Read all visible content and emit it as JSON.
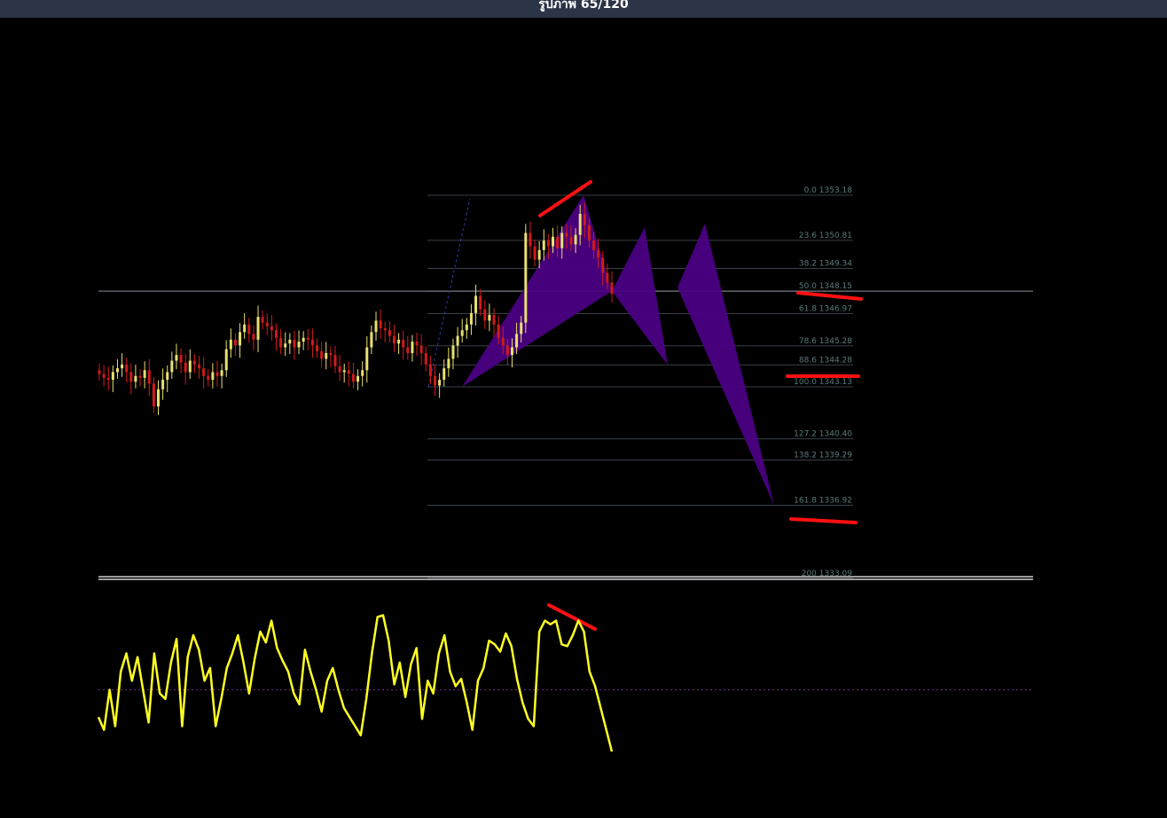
{
  "viewer": {
    "counter": "รูปภาพ 65/120"
  },
  "colors": {
    "background": "#000000",
    "bull_candle": "#e8e070",
    "bear_candle": "#d11a1a",
    "pattern_fill": "#4b0082",
    "indicator": "#ffff22",
    "divergence": "#ff1111",
    "level_line": "#8a8f99"
  },
  "chart_data": [
    {
      "type": "candlestick",
      "instrument_price_scale": "price",
      "fibonacci_levels": [
        {
          "label": "0.0 1353.18",
          "price": 1353.18
        },
        {
          "label": "23.6 1350.81",
          "price": 1350.81
        },
        {
          "label": "38.2 1349.34",
          "price": 1349.34
        },
        {
          "label": "50.0 1348.15",
          "price": 1348.15
        },
        {
          "label": "61.8 1346.97",
          "price": 1346.97
        },
        {
          "label": "78.6 1345.28",
          "price": 1345.28
        },
        {
          "label": "88.6 1344.28",
          "price": 1344.28
        },
        {
          "label": "100.0 1343.13",
          "price": 1343.13
        },
        {
          "label": "127.2 1340.40",
          "price": 1340.4
        },
        {
          "label": "138.2 1339.29",
          "price": 1339.29
        },
        {
          "label": "161.8 1336.92",
          "price": 1336.92
        },
        {
          "label": "200 1333.09",
          "price": 1333.09
        }
      ],
      "horizontal_line_price": 1348.15,
      "close_path": [
        1343.8,
        1343.6,
        1343.5,
        1343.9,
        1344.1,
        1344.3,
        1343.9,
        1343.4,
        1343.7,
        1343.6,
        1344.0,
        1343.3,
        1342.1,
        1343.0,
        1343.5,
        1343.9,
        1344.5,
        1344.8,
        1344.4,
        1343.9,
        1344.5,
        1344.3,
        1344.1,
        1343.7,
        1343.5,
        1343.9,
        1343.7,
        1344.0,
        1345.1,
        1345.6,
        1345.3,
        1346.0,
        1346.4,
        1345.9,
        1345.6,
        1346.8,
        1346.5,
        1346.3,
        1346.1,
        1345.7,
        1345.2,
        1345.4,
        1345.6,
        1345.2,
        1345.5,
        1345.7,
        1345.6,
        1345.3,
        1345.0,
        1344.6,
        1344.9,
        1344.8,
        1344.2,
        1343.9,
        1344.0,
        1343.8,
        1343.4,
        1343.7,
        1344.0,
        1345.2,
        1346.0,
        1346.6,
        1346.2,
        1346.1,
        1345.8,
        1345.4,
        1345.6,
        1345.2,
        1344.9,
        1345.5,
        1345.3,
        1344.9,
        1344.3,
        1343.7,
        1343.2,
        1343.5,
        1344.1,
        1344.6,
        1345.3,
        1345.8,
        1346.1,
        1346.4,
        1347.0,
        1347.9,
        1347.2,
        1346.6,
        1346.9,
        1346.4,
        1345.7,
        1345.3,
        1344.8,
        1345.2,
        1345.9,
        1346.5,
        1351.2,
        1350.5,
        1349.8,
        1350.3,
        1350.8,
        1350.5,
        1351.0,
        1350.4,
        1351.2,
        1351.0,
        1350.6,
        1351.1,
        1352.2,
        1351.6,
        1350.8,
        1350.3,
        1349.9,
        1349.1,
        1348.6,
        1348.0
      ],
      "harmonic_pattern": {
        "X": 1343.13,
        "A": 1353.18,
        "B": 1348.15,
        "projections": [
          1351.5,
          1344.28,
          1351.7,
          1336.92
        ]
      }
    },
    {
      "type": "line",
      "name": "",
      "reference_level": 50,
      "values": [
        35,
        28,
        50,
        30,
        60,
        70,
        55,
        68,
        50,
        32,
        70,
        48,
        45,
        65,
        78,
        30,
        68,
        80,
        72,
        55,
        62,
        30,
        45,
        62,
        70,
        80,
        65,
        48,
        67,
        82,
        76,
        88,
        73,
        66,
        60,
        48,
        42,
        72,
        60,
        50,
        38,
        55,
        62,
        50,
        40,
        35,
        30,
        25,
        45,
        70,
        90,
        91,
        77,
        53,
        65,
        46,
        64,
        73,
        34,
        55,
        48,
        70,
        80,
        60,
        52,
        56,
        43,
        28,
        55,
        62,
        77,
        75,
        71,
        81,
        74,
        56,
        43,
        34,
        30,
        82,
        88,
        86,
        88,
        75,
        74,
        80,
        88,
        82,
        60,
        52,
        40,
        28,
        16
      ]
    }
  ]
}
